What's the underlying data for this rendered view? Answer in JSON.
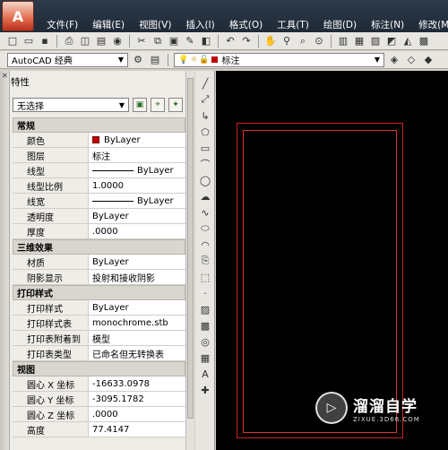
{
  "menubar": {
    "app_icon": "autocad-logo-icon",
    "items": [
      "文件(F)",
      "编辑(E)",
      "视图(V)",
      "插入(I)",
      "格式(O)",
      "工具(T)",
      "绘图(D)",
      "标注(N)",
      "修改(M)"
    ]
  },
  "toolbar2": {
    "workspace": "AutoCAD 经典",
    "layer": "标注"
  },
  "panel": {
    "title": "特性",
    "selection": "无选择",
    "sections": [
      {
        "title": "常规",
        "rows": [
          {
            "key": "颜色",
            "value": "ByLayer",
            "swatch": "#c00000"
          },
          {
            "key": "图层",
            "value": "标注"
          },
          {
            "key": "线型",
            "value": "ByLayer",
            "line": true
          },
          {
            "key": "线型比例",
            "value": "1.0000"
          },
          {
            "key": "线宽",
            "value": "ByLayer",
            "line": true
          },
          {
            "key": "透明度",
            "value": "ByLayer"
          },
          {
            "key": "厚度",
            "value": ".0000"
          }
        ]
      },
      {
        "title": "三维效果",
        "rows": [
          {
            "key": "材质",
            "value": "ByLayer"
          },
          {
            "key": "阴影显示",
            "value": "投射和接收阴影"
          }
        ]
      },
      {
        "title": "打印样式",
        "rows": [
          {
            "key": "打印样式",
            "value": "ByLayer"
          },
          {
            "key": "打印样式表",
            "value": "monochrome.stb"
          },
          {
            "key": "打印表附着到",
            "value": "模型"
          },
          {
            "key": "打印表类型",
            "value": "已命名但无转换表"
          }
        ]
      },
      {
        "title": "视图",
        "rows": [
          {
            "key": "圆心 X 坐标",
            "value": "-16633.0978"
          },
          {
            "key": "圆心 Y 坐标",
            "value": "-3095.1782"
          },
          {
            "key": "圆心 Z 坐标",
            "value": ".0000"
          },
          {
            "key": "高度",
            "value": "77.4147"
          }
        ]
      }
    ]
  },
  "watermark": {
    "title": "溜溜自学",
    "subtitle": "ZIXUE.3D66.COM"
  },
  "colors": {
    "canvas": "#000000",
    "frame": "#cc2222",
    "swatch": "#c00000"
  }
}
